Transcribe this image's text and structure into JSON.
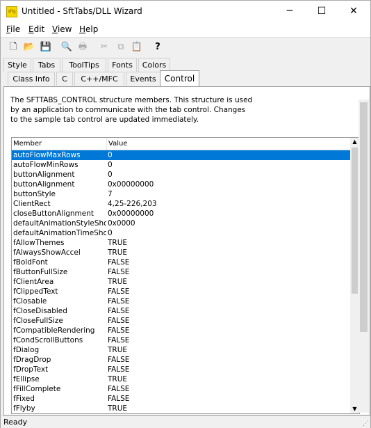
{
  "window": {
    "title": "Untitled - SftTabs/DLL Wizard",
    "app_icon_text": "sftg",
    "minimize_glyph": "─",
    "maximize_glyph": "☐",
    "close_glyph": "✕"
  },
  "menu": {
    "file": {
      "u": "F",
      "rest": "ile"
    },
    "edit": {
      "u": "E",
      "rest": "dit"
    },
    "view": {
      "u": "V",
      "rest": "iew"
    },
    "help": {
      "u": "H",
      "rest": "elp"
    }
  },
  "toolbar_icons": [
    "new-icon",
    "open-icon",
    "save-icon",
    "print-preview-icon",
    "print-icon",
    "cut-icon",
    "copy-icon",
    "paste-icon",
    "help-icon"
  ],
  "toolbar_glyphs": [
    "🗋",
    "📂",
    "💾",
    "🔍",
    "🖶",
    "✂",
    "⧉",
    "📋",
    "?"
  ],
  "tabs_row1": [
    "Style",
    "Tabs",
    "ToolTips",
    "Fonts",
    "Colors"
  ],
  "tabs_row2": [
    "Class Info",
    "C",
    "C++/MFC",
    "Events",
    "Control"
  ],
  "active_tab": "Control",
  "description": "The SFTTABS_CONTROL structure members.  This structure is used by an application to communicate with the tab control.  Changes to the sample tab control are updated immediately.",
  "list": {
    "headers": [
      "Member",
      "Value"
    ],
    "rows": [
      [
        "autoFlowMaxRows",
        "0"
      ],
      [
        "autoFlowMinRows",
        "0"
      ],
      [
        "buttonAlignment",
        "0"
      ],
      [
        "buttonAlignment",
        "0x00000000"
      ],
      [
        "buttonStyle",
        "7"
      ],
      [
        "ClientRect",
        "4,25-226,203"
      ],
      [
        "closeButtonAlignment",
        "0x00000000"
      ],
      [
        "defaultAnimationStyleShow",
        "0x0000"
      ],
      [
        "defaultAnimationTimeShow",
        "0"
      ],
      [
        "fAllowThemes",
        "TRUE"
      ],
      [
        "fAlwaysShowAccel",
        "TRUE"
      ],
      [
        "fBoldFont",
        "FALSE"
      ],
      [
        "fButtonFullSize",
        "FALSE"
      ],
      [
        "fClientArea",
        "TRUE"
      ],
      [
        "fClippedText",
        "FALSE"
      ],
      [
        "fClosable",
        "FALSE"
      ],
      [
        "fCloseDisabled",
        "FALSE"
      ],
      [
        "fCloseFullSize",
        "FALSE"
      ],
      [
        "fCompatibleRendering",
        "FALSE"
      ],
      [
        "fCondScrollButtons",
        "FALSE"
      ],
      [
        "fDialog",
        "TRUE"
      ],
      [
        "fDragDrop",
        "FALSE"
      ],
      [
        "fDropText",
        "FALSE"
      ],
      [
        "fEllipse",
        "TRUE"
      ],
      [
        "fFillComplete",
        "FALSE"
      ],
      [
        "fFixed",
        "FALSE"
      ],
      [
        "fFlyby",
        "TRUE"
      ]
    ],
    "selected_index": 0
  },
  "status": {
    "text": "Ready"
  },
  "colors": {
    "selection": "#0078d7"
  }
}
